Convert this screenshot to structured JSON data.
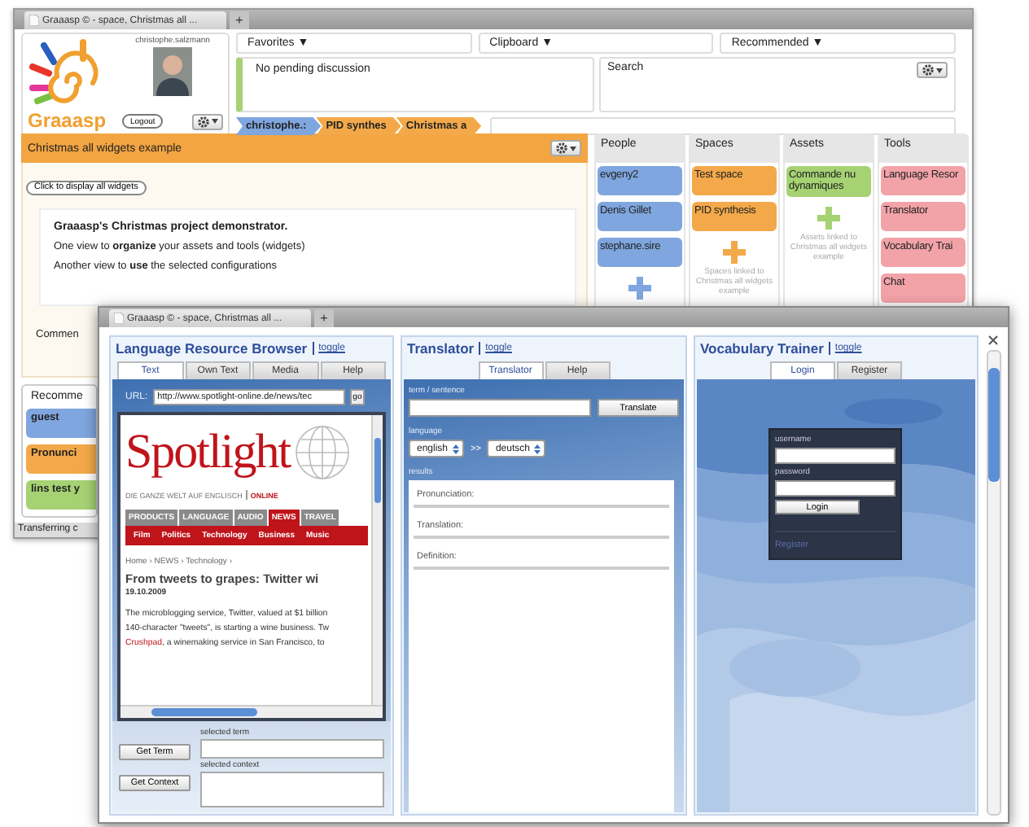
{
  "back_window": {
    "tab": {
      "title": "Graaasp © - space, Christmas all ...",
      "new_tab": "+"
    },
    "brand": "Graaasp",
    "user": "christophe.salzmann",
    "logout": "Logout",
    "menus": [
      "Favorites ▼",
      "Clipboard ▼",
      "Recommended ▼"
    ],
    "discussion": "No pending discussion",
    "search": {
      "label": "Search"
    },
    "breadcrumb": [
      {
        "label": "christophe.:",
        "color": "#7fa6de"
      },
      {
        "label": "PID synthes",
        "color": "#f3a94a"
      },
      {
        "label": "Christmas a",
        "color": "#f3a94a"
      }
    ],
    "space": {
      "title": "Christmas all widgets example",
      "display_button": "Click to display all widgets",
      "heading": "Graaasp's Christmas project demonstrator.",
      "lines": [
        "One view to **organize** your assets and tools (widgets)",
        "Another view to **use** the selected configurations"
      ],
      "comments_label": "Commen"
    },
    "recommended": {
      "title": "Recomme",
      "items": [
        {
          "label": "guest",
          "color": "#7fa6de"
        },
        {
          "label": "Pronunci",
          "color": "#f3a94a"
        },
        {
          "label": "lins test y",
          "color": "#a6d273"
        }
      ]
    },
    "columns": [
      {
        "title": "People",
        "color": "#7fa6de",
        "items": [
          "evgeny2",
          "Denis Gillet",
          "stephane.sire"
        ],
        "add": true
      },
      {
        "title": "Spaces",
        "color": "#f3a94a",
        "items": [
          "Test space",
          "PID synthesis"
        ],
        "add": true,
        "note": "Spaces linked to Christmas all widgets example"
      },
      {
        "title": "Assets",
        "color": "#a6d273",
        "items": [
          "Commande nu dynamiques"
        ],
        "add": true,
        "note": "Assets linked to Christmas all widgets example"
      },
      {
        "title": "Tools",
        "color": "#f2a3a8",
        "items": [
          "Language Resor",
          "Translator",
          "Vocabulary Trai",
          "Chat"
        ]
      }
    ],
    "status": "Transferring c"
  },
  "front_window": {
    "tab": {
      "title": "Graaasp © - space, Christmas all ...",
      "new_tab": "+"
    },
    "widgets": [
      {
        "kind": "resource_browser",
        "title": "Language Resource Browser",
        "toggle": "toggle",
        "tabs": [
          {
            "label": "Text",
            "selected": true
          },
          {
            "label": "Own Text",
            "selected": false
          },
          {
            "label": "Media",
            "selected": false
          },
          {
            "label": "Help",
            "selected": false
          }
        ],
        "url_label": "URL:",
        "url": "http://www.spotlight-online.de/news/tec",
        "go": "go",
        "page": {
          "logo": "Spotlight",
          "tagline": "DIE GANZE WELT AUF ENGLISCH",
          "tagline_suffix": "ONLINE",
          "nav": [
            {
              "label": "PRODUCTS",
              "selected": false
            },
            {
              "label": "LANGUAGE",
              "selected": false
            },
            {
              "label": "AUDIO",
              "selected": false
            },
            {
              "label": "NEWS",
              "selected": true
            },
            {
              "label": "TRAVEL",
              "selected": false
            }
          ],
          "subnav": [
            "Film",
            "Politics",
            "Technology",
            "Business",
            "Music"
          ],
          "crumbs": "Home › NEWS › Technology ›",
          "headline": "From tweets to grapes: Twitter wi",
          "date": "19.10.2009",
          "paragraph": {
            "lines": [
              "The microblogging service, Twitter, valued at $1 billion",
              "140-character \"tweets\", is starting a wine business. Tw"
            ],
            "link": "Crushpad",
            "tail": ", a winemaking service in San Francisco, to"
          }
        },
        "get_term": "Get Term",
        "get_context": "Get Context",
        "term_label": "selected term",
        "context_label": "selected context"
      },
      {
        "kind": "translator",
        "title": "Translator",
        "toggle": "toggle",
        "tabs": [
          {
            "label": "Translator",
            "selected": true
          },
          {
            "label": "Help",
            "selected": false
          }
        ],
        "term_label": "term / sentence",
        "translate": "Translate",
        "language_label": "language",
        "from": "english",
        "arrow": ">>",
        "to": "deutsch",
        "results_label": "results",
        "results": [
          "Pronunciation:",
          "Translation:",
          "Definition:"
        ]
      },
      {
        "kind": "vocabulary_trainer",
        "title": "Vocabulary Trainer",
        "toggle": "toggle",
        "tabs": [
          {
            "label": "Login",
            "selected": true
          },
          {
            "label": "Register",
            "selected": false
          }
        ],
        "username_label": "username",
        "password_label": "password",
        "login": "Login",
        "register": "Register"
      }
    ]
  }
}
